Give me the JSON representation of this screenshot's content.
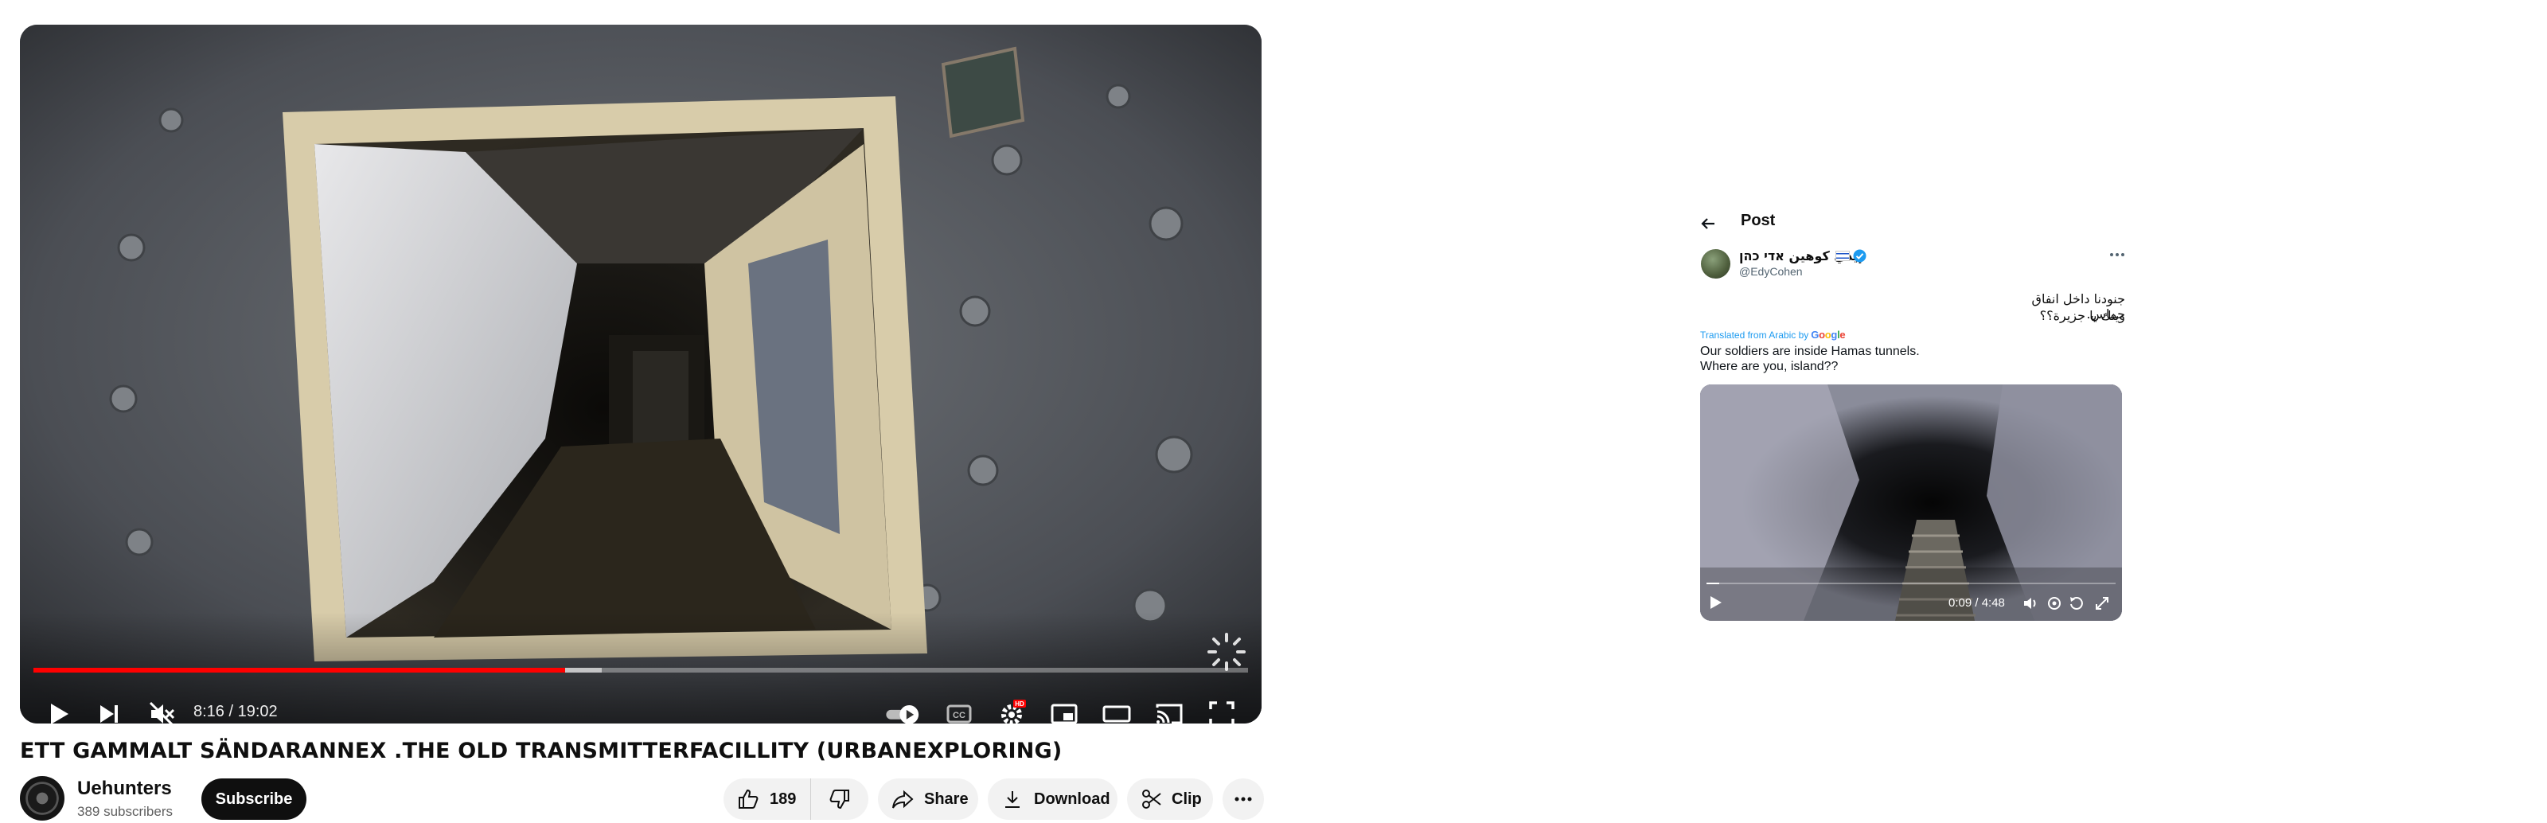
{
  "player": {
    "time": "8:16 / 19:02",
    "played_fraction": 0.438,
    "buffered_fraction": 0.468,
    "settings_badge": "HD",
    "controls": [
      "play-icon",
      "next-icon",
      "mute-icon",
      "autoplay-toggle",
      "captions-icon",
      "settings-icon",
      "miniplayer-icon",
      "theater-icon",
      "cast-icon",
      "fullscreen-icon"
    ]
  },
  "video": {
    "title": "ETT GAMMALT SÄNDARANNEX .THE OLD TRANSMITTERFACILLITY (URBANEXPLORING)"
  },
  "channel": {
    "name": "Uehunters",
    "subscribers": "389 subscribers",
    "subscribe_label": "Subscribe"
  },
  "actions": {
    "likes": "189",
    "share_label": "Share",
    "download_label": "Download",
    "clip_label": "Clip"
  },
  "tweet": {
    "heading": "Post",
    "display_name": "إيدي كوهين אדי כהן",
    "handle": "@EdyCohen",
    "arabic_line1": "جنودنا داخل انفاق حماس.",
    "arabic_line2": "وينك يا جزيرة؟؟",
    "translated_prefix": "Translated from Arabic by",
    "translator": "Google",
    "english_line1": "Our soldiers are inside Hamas tunnels.",
    "english_line2": "Where are you, island??",
    "media_time": "0:09 / 4:48",
    "media_played_fraction": 0.031,
    "colors": {
      "link": "#1d9bf0",
      "verified": "#1d9bf0"
    }
  },
  "colors": {
    "progress": "#ff0000",
    "pill_bg": "#f2f2f2"
  }
}
